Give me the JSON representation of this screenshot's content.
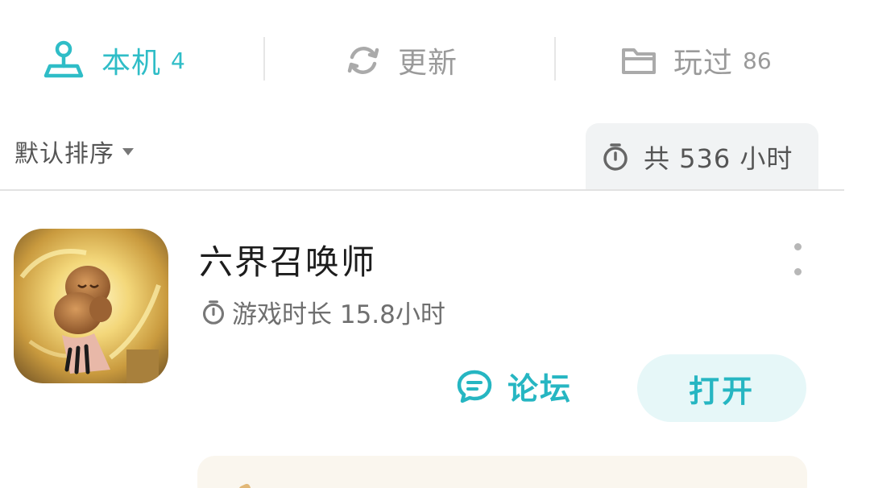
{
  "tabs": [
    {
      "label": "本机",
      "count": "4",
      "icon": "joystick-icon",
      "active": true
    },
    {
      "label": "更新",
      "icon": "refresh-icon",
      "active": false
    },
    {
      "label": "玩过",
      "count": "86",
      "icon": "folder-icon",
      "active": false
    }
  ],
  "toolbar": {
    "sort_label": "默认排序",
    "total_label": "共 536 小时"
  },
  "games": [
    {
      "title": "六界召唤师",
      "playtime_label": "游戏时长 15.8小时",
      "forum_label": "论坛",
      "open_label": "打开"
    }
  ],
  "colors": {
    "accent": "#2fbdc7",
    "inactive_text": "#9a9a9a",
    "open_button_bg": "#e6f7f8",
    "total_box_bg": "#f1f3f4",
    "promo_bg": "#faf6ee"
  }
}
